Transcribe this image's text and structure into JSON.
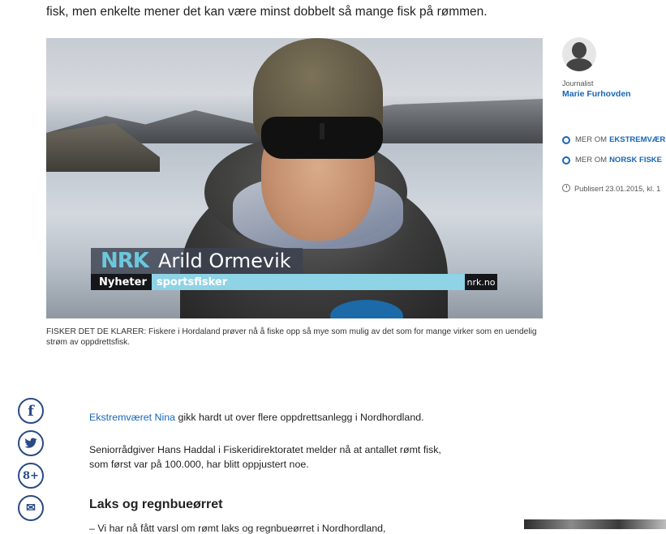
{
  "article": {
    "intro_tail": "fisk, men enkelte mener det kan være minst dobbelt så mange fisk på rømmen.",
    "caption": "FISKER DET DE KLARER: Fiskere i Hordaland prøver nå å fiske opp så mye som mulig av det som for mange virker som en uendelig strøm av oppdrettsfisk.",
    "p1_link": "Ekstremværet Nina",
    "p1_rest": " gikk hardt ut over flere oppdrettsanlegg i Nordhordland.",
    "p2": "Seniorrådgiver Hans Haddal i Fiskeridirektoratet melder nå at antallet rømt fisk, som først var på 100.000, har blitt oppjustert noe.",
    "heading": "Laks og regnbueørret",
    "p3_partial": "– Vi har nå fått varsl om rømt laks og regnbueørret i Nordhordland,"
  },
  "video": {
    "logo": "NRK",
    "person_name": "Arild Ormevik",
    "program": "Nyheter",
    "role": "sportsfisker",
    "brand": "nrk.no"
  },
  "sidebar": {
    "journalist_label": "Journalist",
    "journalist_name": "Marie Furhovden",
    "more_prefix": "MER OM",
    "more_topics": [
      "EKSTREMVÆR",
      "NORSK FISKE"
    ],
    "published": "Publisert 23.01.2015, kl. 1"
  },
  "share": {
    "icons": [
      "facebook-icon",
      "twitter-icon",
      "google-plus-icon",
      "email-icon"
    ],
    "facebook": "f",
    "twitter": "t",
    "google": "8+",
    "email": "✉"
  },
  "colors": {
    "link": "#1766b8",
    "share": "#2a4a86",
    "nrk_accent": "#8ed3e6"
  }
}
